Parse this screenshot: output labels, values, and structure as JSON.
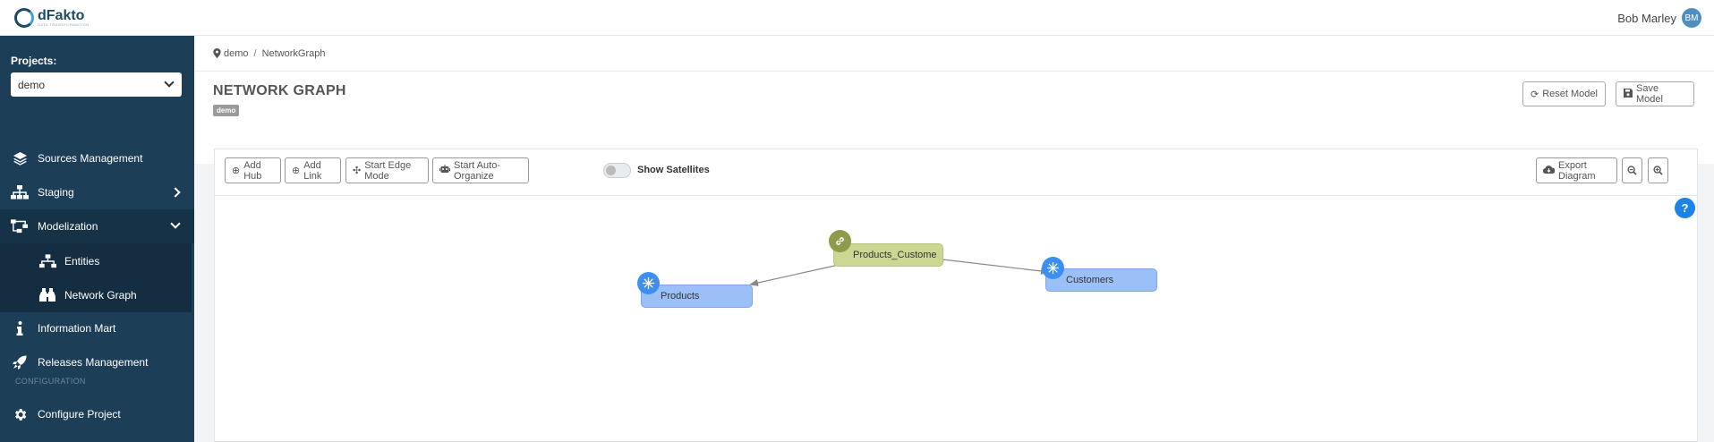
{
  "app": {
    "name": "dFakto",
    "tagline": "DATA TRANSFORMATION"
  },
  "user": {
    "name": "Bob Marley",
    "initials": "BM"
  },
  "sidebar": {
    "projects_label": "Projects:",
    "selected_project": "demo",
    "items": [
      {
        "label": "Sources Management",
        "icon": "layers-icon"
      },
      {
        "label": "Staging",
        "icon": "sitemap-icon"
      },
      {
        "label": "Modelization",
        "icon": "project-diagram-icon"
      },
      {
        "label": "Entities",
        "icon": "sitemap-icon"
      },
      {
        "label": "Network Graph",
        "icon": "binoculars-icon"
      },
      {
        "label": "Information Mart",
        "icon": "info-icon"
      },
      {
        "label": "Releases Management",
        "icon": "rocket-icon"
      }
    ],
    "config_section": "CONFIGURATION",
    "config_item": "Configure Project"
  },
  "breadcrumb": {
    "items": [
      "demo",
      "NetworkGraph"
    ]
  },
  "header": {
    "title": "NETWORK GRAPH",
    "badge": "demo",
    "reset_label": "Reset Model",
    "save_label": "Save Model"
  },
  "toolbar": {
    "add_hub": "Add Hub",
    "add_link": "Add Link",
    "edge_mode": "Start Edge Mode",
    "auto_organize": "Start Auto-Organize",
    "show_satellites": "Show Satellites",
    "show_satellites_on": false,
    "export": "Export Diagram"
  },
  "graph": {
    "nodes": [
      {
        "id": "products",
        "label": "Products",
        "type": "hub"
      },
      {
        "id": "products_customers",
        "label": "Products_Custome",
        "type": "link"
      },
      {
        "id": "customers",
        "label": "Customers",
        "type": "hub"
      }
    ],
    "edges": [
      {
        "from": "products_customers",
        "to": "products"
      },
      {
        "from": "products_customers",
        "to": "customers"
      }
    ]
  },
  "colors": {
    "sidebar": "#1d3e57",
    "hub": "#9bbff7",
    "hub_icon": "#3c8ef2",
    "link": "#cbd793",
    "link_icon": "#8f9a4a",
    "help": "#1a83e6"
  }
}
